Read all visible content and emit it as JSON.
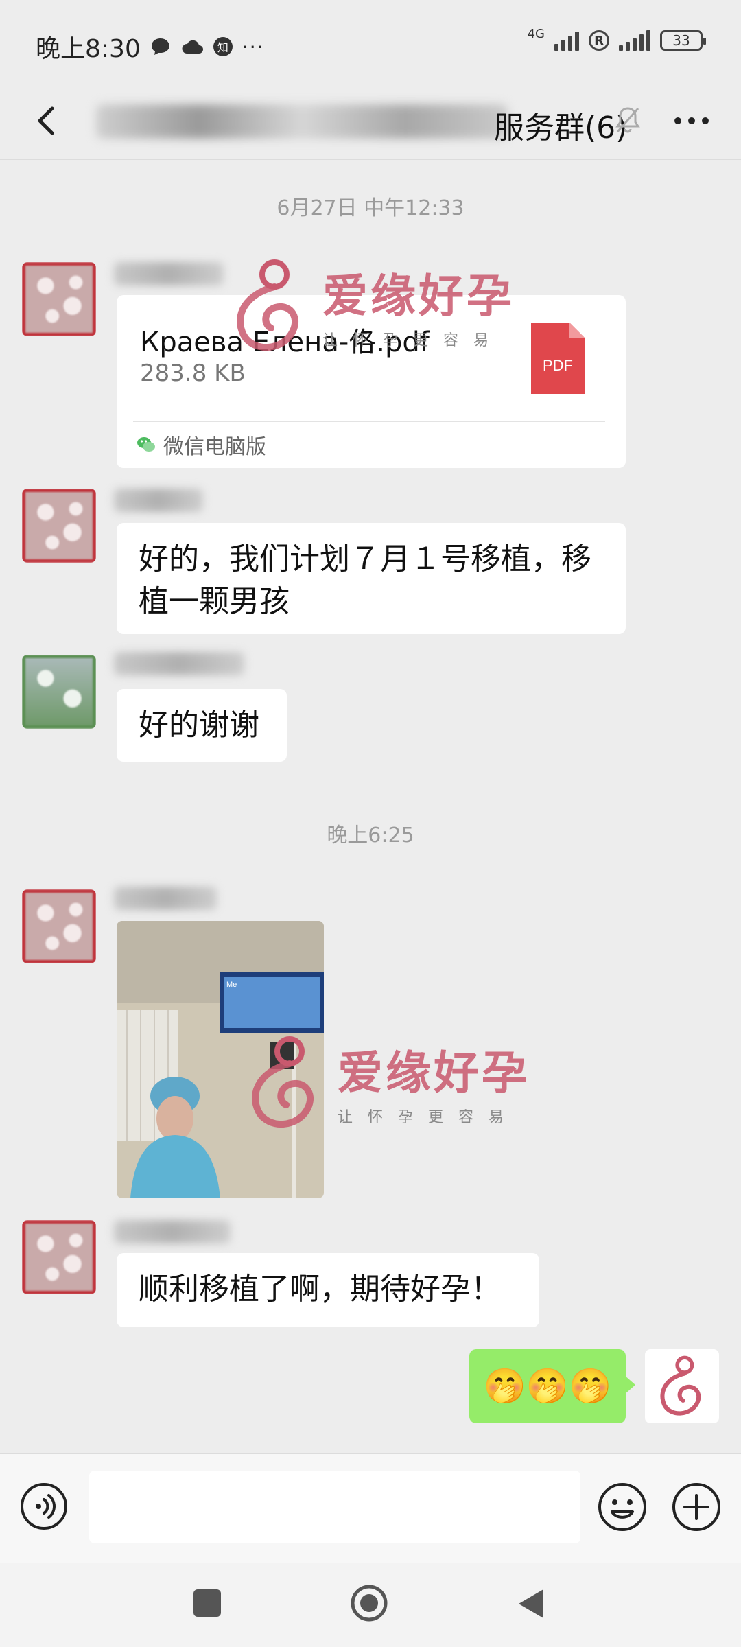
{
  "status_bar": {
    "time": "晚上8:30",
    "notif_badge": "知",
    "more": "···",
    "network": "4G",
    "roaming": "R",
    "battery": "33"
  },
  "header": {
    "title_visible_part": "服务群(6)",
    "back_icon": "chevron-left-icon",
    "mute_icon": "bell-off-icon",
    "more_icon": "more-dots-icon"
  },
  "messages": {
    "ts1": "6月27日 中午12:33",
    "file": {
      "name": "Краева Елена-佫.pdf",
      "size": "283.8 KB",
      "type_label": "PDF",
      "source": "微信电脑版"
    },
    "msg2": "好的，我们计划７月１号移植，移植一颗男孩",
    "msg3": "好的谢谢",
    "ts2": "晚上6:25",
    "photo_screen_label": "Me",
    "msg5": "顺利移植了啊，期待好孕！",
    "self_msg": "🤭🤭🤭"
  },
  "watermark": {
    "title": "爱缘好孕",
    "subtitle": "让怀孕更容易"
  },
  "colors": {
    "background": "#ededed",
    "self_bubble": "#95ec69",
    "pdf_red": "#e0474c",
    "brand_pink": "#c9596e"
  }
}
